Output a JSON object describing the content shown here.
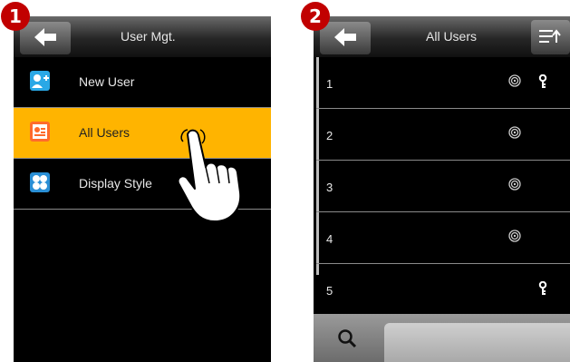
{
  "steps": [
    "1",
    "2"
  ],
  "screen1": {
    "title": "User Mgt.",
    "menu": [
      {
        "label": "New User",
        "icon": "new-user-icon"
      },
      {
        "label": "All Users",
        "icon": "all-users-icon",
        "selected": true
      },
      {
        "label": "Display Style",
        "icon": "display-style-icon"
      }
    ]
  },
  "screen2": {
    "title": "All Users",
    "users": [
      {
        "num": "1",
        "fingerprint": true,
        "password": true
      },
      {
        "num": "2",
        "fingerprint": true,
        "password": false
      },
      {
        "num": "3",
        "fingerprint": true,
        "password": false
      },
      {
        "num": "4",
        "fingerprint": true,
        "password": false
      },
      {
        "num": "5",
        "fingerprint": false,
        "password": true
      }
    ]
  },
  "colors": {
    "selected": "#ffb400",
    "badge": "#c10000",
    "background": "#000000"
  }
}
